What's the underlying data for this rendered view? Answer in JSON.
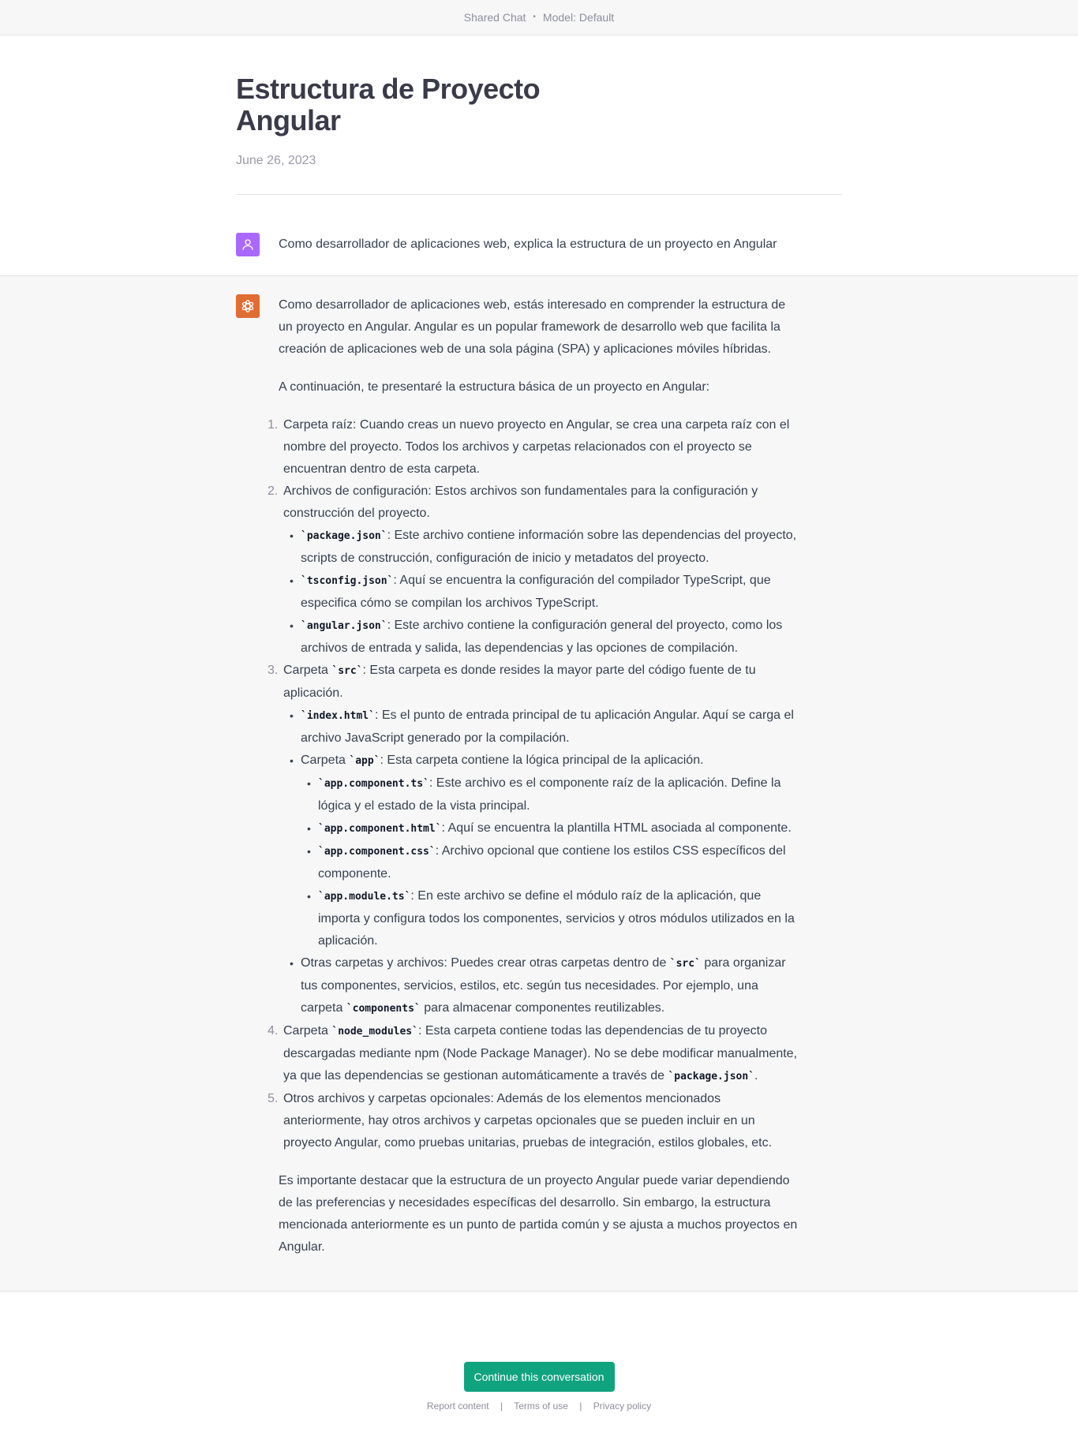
{
  "topbar": {
    "shared": "Shared Chat",
    "sep": "•",
    "model": "Model: Default"
  },
  "header": {
    "title": "Estructura de Proyecto Angular",
    "date": "June 26, 2023"
  },
  "user_message": "Como desarrollador de aplicaciones web, explica la estructura de un proyecto en Angular",
  "assistant": {
    "intro": "Como desarrollador de aplicaciones web, estás interesado en comprender la estructura de un proyecto en Angular. Angular es un popular framework de desarrollo web que facilita la creación de aplicaciones web de una sola página (SPA) y aplicaciones móviles híbridas.",
    "lead": "A continuación, te presentaré la estructura básica de un proyecto en Angular:",
    "items": {
      "i1": {
        "num": "1.",
        "text": "Carpeta raíz: Cuando creas un nuevo proyecto en Angular, se crea una carpeta raíz con el nombre del proyecto. Todos los archivos y carpetas relacionados con el proyecto se encuentran dentro de esta carpeta."
      },
      "i2": {
        "num": "2.",
        "text": "Archivos de configuración: Estos archivos son fundamentales para la configuración y construcción del proyecto.",
        "b1_code": "package.json",
        "b1_text": ": Este archivo contiene información sobre las dependencias del proyecto, scripts de construcción, configuración de inicio y metadatos del proyecto.",
        "b2_code": "tsconfig.json",
        "b2_text": ": Aquí se encuentra la configuración del compilador TypeScript, que especifica cómo se compilan los archivos TypeScript.",
        "b3_code": "angular.json",
        "b3_text": ": Este archivo contiene la configuración general del proyecto, como los archivos de entrada y salida, las dependencias y las opciones de compilación."
      },
      "i3": {
        "num": "3.",
        "pre": "Carpeta ",
        "code": "src",
        "text": ": Esta carpeta es donde resides la mayor parte del código fuente de tu aplicación.",
        "b1_code": "index.html",
        "b1_text": ": Es el punto de entrada principal de tu aplicación Angular. Aquí se carga el archivo JavaScript generado por la compilación.",
        "b2_pre": "Carpeta ",
        "b2_code": "app",
        "b2_text": ": Esta carpeta contiene la lógica principal de la aplicación.",
        "c1_code": "app.component.ts",
        "c1_text": ": Este archivo es el componente raíz de la aplicación. Define la lógica y el estado de la vista principal.",
        "c2_code": "app.component.html",
        "c2_text": ": Aquí se encuentra la plantilla HTML asociada al componente.",
        "c3_code": "app.component.css",
        "c3_text": ": Archivo opcional que contiene los estilos CSS específicos del componente.",
        "c4_code": "app.module.ts",
        "c4_text": ": En este archivo se define el módulo raíz de la aplicación, que importa y configura todos los componentes, servicios y otros módulos utilizados en la aplicación.",
        "b3_pre": "Otras carpetas y archivos: Puedes crear otras carpetas dentro de ",
        "b3_code": "src",
        "b3_mid": " para organizar tus componentes, servicios, estilos, etc. según tus necesidades. Por ejemplo, una carpeta ",
        "b3_code2": "components",
        "b3_post": " para almacenar componentes reutilizables."
      },
      "i4": {
        "num": "4.",
        "pre": "Carpeta ",
        "code": "node_modules",
        "text": ": Esta carpeta contiene todas las dependencias de tu proyecto descargadas mediante npm (Node Package Manager). No se debe modificar manualmente, ya que las dependencias se gestionan automáticamente a través de ",
        "code2": "package.json",
        "post": "."
      },
      "i5": {
        "num": "5.",
        "text": "Otros archivos y carpetas opcionales: Además de los elementos mencionados anteriormente, hay otros archivos y carpetas opcionales que se pueden incluir en un proyecto Angular, como pruebas unitarias, pruebas de integración, estilos globales, etc."
      }
    },
    "outro": "Es importante destacar que la estructura de un proyecto Angular puede variar dependiendo de las preferencias y necesidades específicas del desarrollo. Sin embargo, la estructura mencionada anteriormente es un punto de partida común y se ajusta a muchos proyectos en Angular."
  },
  "footer": {
    "continue": "Continue this conversation",
    "report": "Report content",
    "sep": "|",
    "terms": "Terms of use",
    "privacy": "Privacy policy"
  },
  "colors": {
    "accent": "#10a37f",
    "user_avatar": "#ab68ff",
    "bot_avatar": "#e06d34"
  },
  "icons": {
    "user": "user-icon",
    "assistant": "openai-logo-icon"
  }
}
